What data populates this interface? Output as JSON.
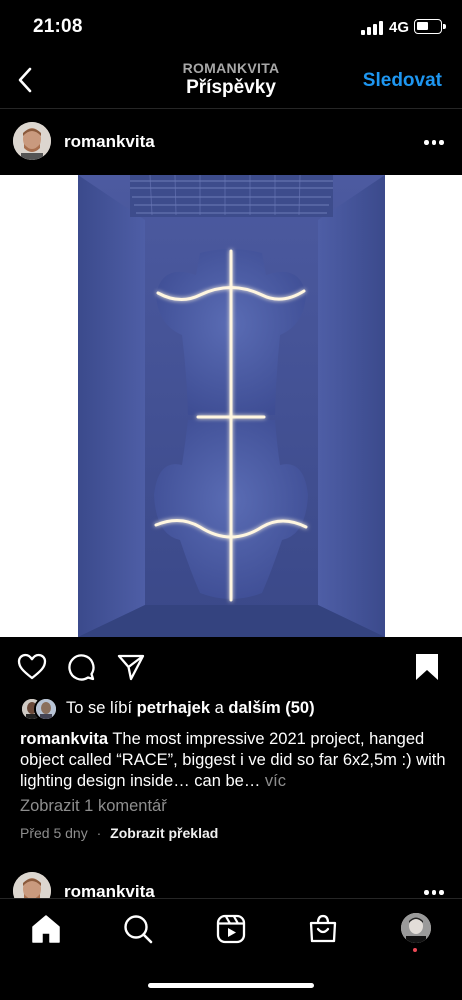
{
  "status_bar": {
    "time": "21:08",
    "network": "4G",
    "battery_level": 0.5
  },
  "header": {
    "username": "ROMANKVITA",
    "title": "Příspěvky",
    "follow_label": "Sledovat"
  },
  "post": {
    "author": "romankvita",
    "likes": {
      "prefix": "To se líbí",
      "user": "petrhajek",
      "conjunction": "a",
      "others": "dalším (50)"
    },
    "caption": {
      "author": "romankvita",
      "text": "The most impressive 2021 project, hanged object called “RACE”, biggest i ve did so far 6x2,5m :) with lighting design inside… can be…",
      "more": "víc"
    },
    "comments_link": "Zobrazit 1 komentář",
    "timestamp": "Před 5 dny",
    "separator": "·",
    "translate_label": "Zobrazit překlad"
  },
  "next_post": {
    "author": "romankvita"
  },
  "icons": {
    "back": "chevron-left-icon",
    "more": "more-horizontal-icon",
    "like": "heart-icon",
    "comment": "comment-icon",
    "share": "send-icon",
    "save": "bookmark-icon",
    "home": "home-icon",
    "search": "search-icon",
    "reels": "reels-icon",
    "shop": "shop-icon"
  },
  "colors": {
    "accent": "#1e96f0",
    "background": "#000000",
    "secondary_text": "#8e8e8e",
    "notification": "#ed4956"
  }
}
